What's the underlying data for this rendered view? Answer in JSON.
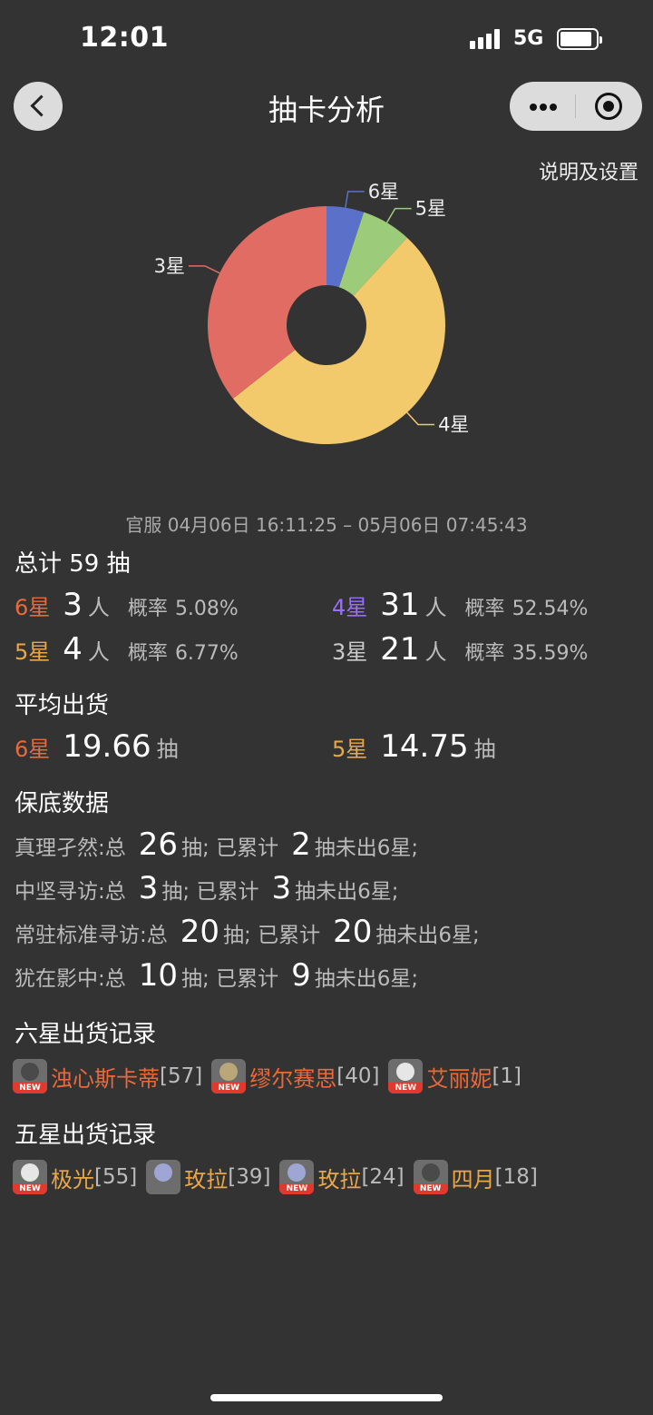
{
  "status_bar": {
    "time": "12:01",
    "network": "5G"
  },
  "header": {
    "title": "抽卡分析"
  },
  "settings_link": "说明及设置",
  "chart_data": {
    "type": "pie",
    "title": "",
    "labels": [
      "6星",
      "5星",
      "4星",
      "3星"
    ],
    "values": [
      3,
      4,
      31,
      21
    ],
    "colors": [
      "#5b70c9",
      "#9ccc7a",
      "#f2c96b",
      "#e06c64"
    ],
    "donut": true
  },
  "time_range": "官服 04月06日 16:11:25 – 05月06日 07:45:43",
  "summary": {
    "total_label": "总计 59 抽",
    "rows": [
      {
        "star": "6星",
        "count": "3",
        "unit": "人",
        "rate_label": "概率",
        "rate": "5.08%"
      },
      {
        "star": "5星",
        "count": "4",
        "unit": "人",
        "rate_label": "概率",
        "rate": "6.77%"
      },
      {
        "star": "4星",
        "count": "31",
        "unit": "人",
        "rate_label": "概率",
        "rate": "52.54%"
      },
      {
        "star": "3星",
        "count": "21",
        "unit": "人",
        "rate_label": "概率",
        "rate": "35.59%"
      }
    ]
  },
  "average": {
    "title": "平均出货",
    "six": {
      "star": "6星",
      "value": "19.66",
      "unit": "抽"
    },
    "five": {
      "star": "5星",
      "value": "14.75",
      "unit": "抽"
    }
  },
  "pity": {
    "title": "保底数据",
    "rows": [
      {
        "pool": "真理孑然:总",
        "total": "26",
        "mid": "抽; 已累计",
        "acc": "2",
        "tail": "抽未出6星;"
      },
      {
        "pool": "中坚寻访:总",
        "total": "3",
        "mid": "抽; 已累计",
        "acc": "3",
        "tail": "抽未出6星;"
      },
      {
        "pool": "常驻标准寻访:总",
        "total": "20",
        "mid": "抽; 已累计",
        "acc": "20",
        "tail": "抽未出6星;"
      },
      {
        "pool": "犹在影中:总",
        "total": "10",
        "mid": "抽; 已累计",
        "acc": "9",
        "tail": "抽未出6星;"
      }
    ]
  },
  "six_star_records": {
    "title": "六星出货记录",
    "items": [
      {
        "name": "浊心斯卡蒂",
        "count": "[57]",
        "badge": "NEW"
      },
      {
        "name": "缪尔赛思",
        "count": "[40]",
        "badge": "NEW"
      },
      {
        "name": "艾丽妮",
        "count": "[1]",
        "badge": "NEW"
      }
    ]
  },
  "five_star_records": {
    "title": "五星出货记录",
    "items": [
      {
        "name": "极光",
        "count": "[55]",
        "badge": "NEW"
      },
      {
        "name": "玫拉",
        "count": "[39]",
        "badge": ""
      },
      {
        "name": "玫拉",
        "count": "[24]",
        "badge": "NEW"
      },
      {
        "name": "四月",
        "count": "[18]",
        "badge": "NEW"
      }
    ]
  }
}
